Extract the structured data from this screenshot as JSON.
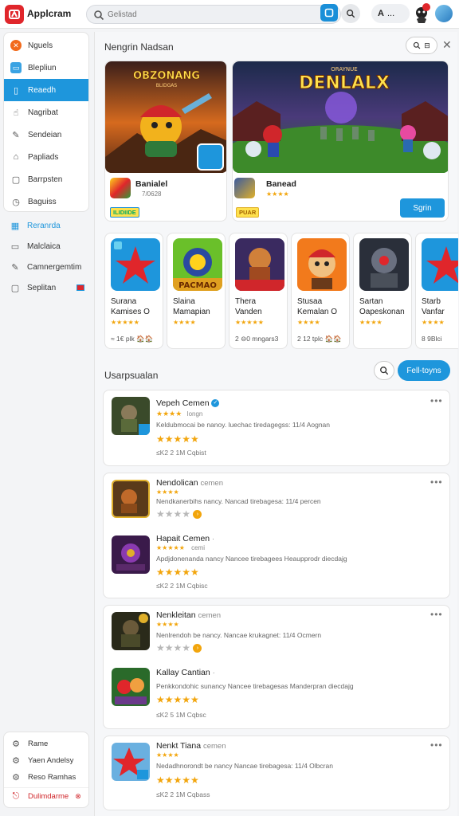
{
  "app": {
    "title": "Applcram"
  },
  "search": {
    "placeholder": "Gelistad"
  },
  "user": {
    "chip": "A",
    "menu": "..."
  },
  "sidebar": {
    "items": [
      {
        "label": "Nguels",
        "icon": "close-circle-icon"
      },
      {
        "label": "Blepliun",
        "icon": "box-icon"
      },
      {
        "label": "Reaedh",
        "icon": "tablet-icon",
        "active": true
      },
      {
        "label": "Nagribat",
        "icon": "hand-icon"
      },
      {
        "label": "Sendeian",
        "icon": "pencil-icon"
      },
      {
        "label": "Papliads",
        "icon": "tag-icon"
      },
      {
        "label": "Barrpsten",
        "icon": "square-icon"
      },
      {
        "label": "Baguiss",
        "icon": "clock-icon"
      }
    ],
    "lower": [
      {
        "label": "Reranrda",
        "icon": "grid-icon"
      },
      {
        "label": "Malclaica",
        "icon": "chat-icon"
      },
      {
        "label": "Camnergemtim",
        "icon": "pencil-icon"
      },
      {
        "label": "Seplitan",
        "icon": "square-icon"
      }
    ],
    "bottom": [
      {
        "label": "Rame",
        "icon": "gear-icon"
      },
      {
        "label": "Yaen Andelsy",
        "icon": "gear-icon"
      },
      {
        "label": "Reso Ramhas",
        "icon": "gear-icon"
      },
      {
        "label": "Dulimdarme",
        "icon": "logout-icon"
      }
    ]
  },
  "featured": {
    "section_title": "Nengrin Nadsan",
    "cards": [
      {
        "art_title": "OBZONANG",
        "art_subtitle": "BLIDGAS",
        "name": "Banialel",
        "sub": "7/0628",
        "badge": "ILIDIIDE"
      },
      {
        "art_title": "DENLALX",
        "art_subtitle": "ORAYNUE",
        "name": "Banead",
        "stars": "★★★★",
        "badge": "PUAR",
        "cta": "Sgrin"
      }
    ]
  },
  "grid": [
    {
      "line1": "Surana",
      "line2": "Kamises O",
      "stars": "★★★★★",
      "meta": "≈ 1€ plk 🏠🏠"
    },
    {
      "line1": "Slaina",
      "line2": "Mamapian",
      "stars": "★★★★",
      "meta": ""
    },
    {
      "line1": "Thera",
      "line2": "Vanden",
      "stars": "★★★★★",
      "meta": "2 ⊖0 mngars3"
    },
    {
      "line1": "Stusaa",
      "line2": "Kemalan O",
      "stars": "★★★★",
      "meta": "2 12 tplc 🏠🏠"
    },
    {
      "line1": "Sartan",
      "line2": "Oapeskonan",
      "stars": "★★★★",
      "meta": ""
    },
    {
      "line1": "Starb",
      "line2": "Vanfar",
      "stars": "★★★★",
      "meta": "8 9Blci"
    }
  ],
  "list": {
    "section_title": "Usarpsualan",
    "filter_label": "Fell-toyns",
    "items": [
      {
        "title": "Vepeh Cemen",
        "tag": "",
        "small": "★★★★",
        "small_tag": "longn",
        "desc": "Keldubmocai be nanoy. luechac tiredagegss: 11/4 Aognan",
        "big": "★★★★★",
        "meta": "≤K2 2 1M   Cqbist",
        "verified": true
      },
      {
        "title": "Nendolican",
        "tag": "cemen",
        "small": "★★★★",
        "desc": "Nendkanerbihs nancy. Nancad tirebagesa: 11/4 percen",
        "grey": "★★★★",
        "meta": ""
      },
      {
        "title": "Hapait Cemen",
        "tag": "cemi",
        "small": "★★★★★",
        "desc": "Apdjdonenanda nancy Nancee tirebagees Heaupprodr diecdajg",
        "big": "★★★★★",
        "meta": "≤K2 2 1M   Cqbisc"
      },
      {
        "title": "Nenkleitan",
        "tag": "cemen",
        "small": "★★★★",
        "desc": "Nenlrendoh be nancy. Nancae krukagnet: 11/4 Ocmern",
        "grey": "★★★★",
        "meta": ""
      },
      {
        "title": "Kallay Cantian",
        "tag": "",
        "small": "",
        "desc": "Penkkondohic sunancy Nancee tirebagesas Manderpran diecdajg",
        "big": "★★★★★",
        "meta": "≤K2 5 1M   Cqbsc"
      },
      {
        "title": "Nenkt Tiana",
        "tag": "cemen",
        "small": "★★★★",
        "desc": "Nedadhnorondt be nancy Nancae tirebagesa: 11/4 Olbcran",
        "big": "★★★★★",
        "meta": "≤K2 2 1M   Cqbass"
      }
    ]
  },
  "colors": {
    "accent": "#1e96dc",
    "brand": "#e0262b",
    "star": "#f2a50c"
  }
}
